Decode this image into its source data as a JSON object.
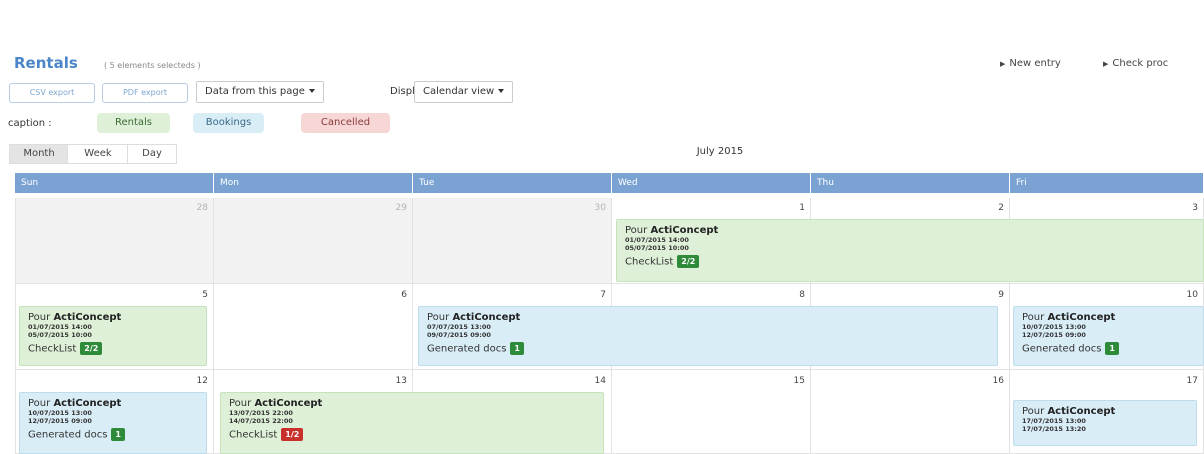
{
  "header": {
    "title": "Rentals",
    "subtitle": "( 5 elements selecteds )",
    "links": [
      "New entry",
      "Check proc"
    ]
  },
  "toolbar": {
    "csv_export": "CSV export",
    "pdf_export": "PDF export",
    "data_select": "Data from this page",
    "display_label": "Display",
    "view_select": "Calendar view"
  },
  "caption": {
    "label": "caption :",
    "rentals": "Rentals",
    "bookings": "Bookings",
    "cancelled": "Cancelled"
  },
  "view_buttons": [
    "Month",
    "Week",
    "Day"
  ],
  "calendar": {
    "month_title": "July 2015",
    "day_headers": [
      "Sun",
      "Mon",
      "Tue",
      "Wed",
      "Thu",
      "Fri"
    ],
    "weeks": [
      [
        "28",
        "29",
        "30",
        "1",
        "2",
        "3"
      ],
      [
        "5",
        "6",
        "7",
        "8",
        "9",
        "10"
      ],
      [
        "12",
        "13",
        "14",
        "15",
        "16",
        "17"
      ]
    ],
    "events": [
      {
        "for": "Pour",
        "company": "ActiConcept",
        "start": "01/07/2015 14:00",
        "end": "05/07/2015 10:00",
        "footer": "CheckList",
        "count": "2/2"
      },
      {
        "for": "Pour",
        "company": "ActiConcept",
        "start": "01/07/2015 14:00",
        "end": "05/07/2015 10:00",
        "footer": "CheckList",
        "count": "2/2"
      },
      {
        "for": "Pour",
        "company": "ActiConcept",
        "start": "07/07/2015 13:00",
        "end": "09/07/2015 09:00",
        "footer": "Generated docs",
        "count": "1"
      },
      {
        "for": "Pour",
        "company": "ActiConcept",
        "start": "10/07/2015 13:00",
        "end": "12/07/2015 09:00",
        "footer": "Generated docs",
        "count": "1"
      },
      {
        "for": "Pour",
        "company": "ActiConcept",
        "start": "10/07/2015 13:00",
        "end": "12/07/2015 09:00",
        "footer": "Generated docs",
        "count": "1"
      },
      {
        "for": "Pour",
        "company": "ActiConcept",
        "start": "13/07/2015 22:00",
        "end": "14/07/2015 22:00",
        "footer": "CheckList",
        "count": "1/2"
      },
      {
        "for": "Pour",
        "company": "ActiConcept",
        "start": "17/07/2015 13:00",
        "end": "17/07/2015 13:20",
        "footer": "",
        "count": ""
      }
    ]
  },
  "colors": {
    "header_blue": "#7aa3d3",
    "title_blue": "#4a86c8",
    "rentals_bg": "#dff0d8",
    "bookings_bg": "#d9edf7",
    "cancelled_bg": "#f7d6d6",
    "count_ok": "#2e8b3a",
    "count_bad": "#c9302c"
  }
}
